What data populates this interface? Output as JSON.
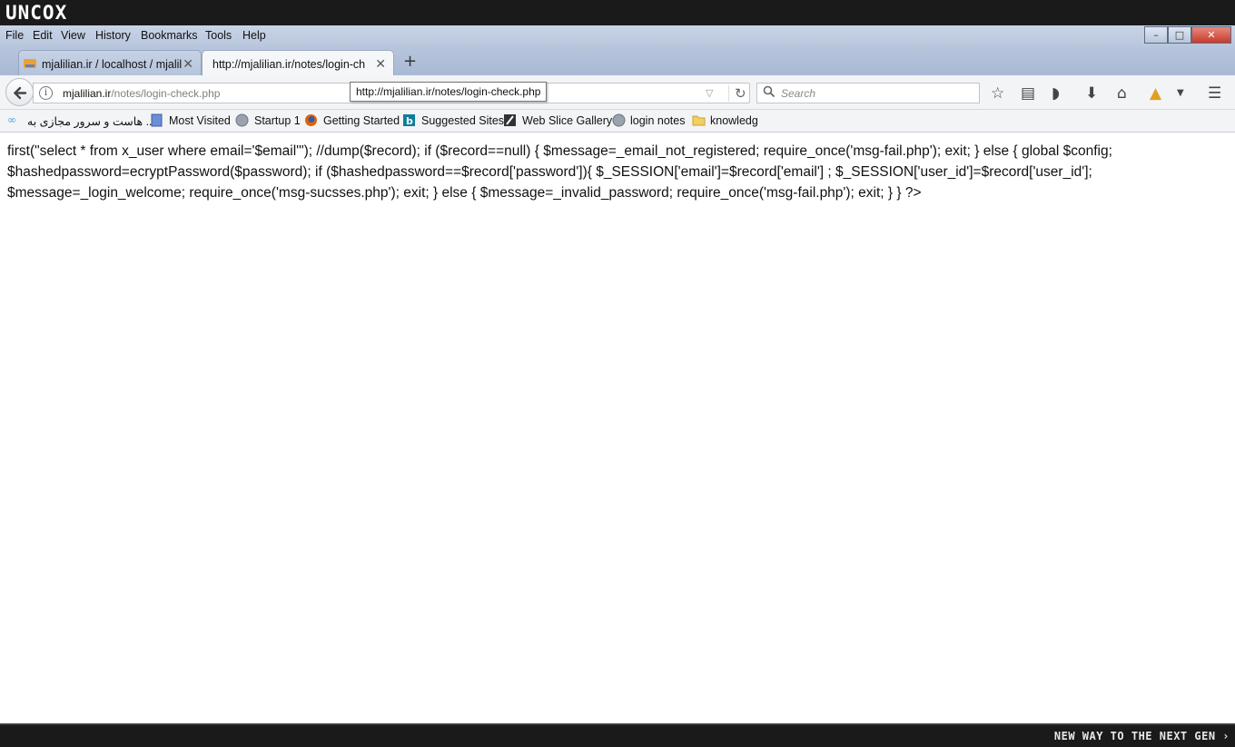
{
  "taskbar": {
    "logo": "UNCOX",
    "slogan": "NEW WAY TO THE NEXT GEN ›"
  },
  "window_controls": {
    "minimize": "–",
    "restore": "□",
    "close": "✕"
  },
  "menubar": {
    "items": [
      "File",
      "Edit",
      "View",
      "History",
      "Bookmarks",
      "Tools",
      "Help"
    ]
  },
  "tabs": [
    {
      "label": "mjalilian.ir / localhost / mjalil",
      "active": false,
      "favicon": "phpmyadmin-icon"
    },
    {
      "label": "http://mjalilian.ir/notes/login-ch",
      "active": true
    }
  ],
  "newtab_label": "+",
  "navbar": {
    "url_host": "mjalilian.ir",
    "url_path": "/notes/login-check.php",
    "tooltip": "http://mjalilian.ir/notes/login-check.php",
    "search_placeholder": "Search"
  },
  "bookmarks": [
    {
      "label": "هاست و سرور مجازی به ...",
      "icon": "link-icon"
    },
    {
      "label": "Most Visited",
      "icon": "bookmark-page-icon"
    },
    {
      "label": "Startup 1",
      "icon": "globe-icon"
    },
    {
      "label": "Getting Started",
      "icon": "firefox-icon"
    },
    {
      "label": "Suggested Sites",
      "icon": "bing-icon"
    },
    {
      "label": "Web Slice Gallery",
      "icon": "webslice-icon"
    },
    {
      "label": "login notes",
      "icon": "globe-icon"
    },
    {
      "label": "knowledg",
      "icon": "folder-icon"
    }
  ],
  "page": {
    "text": "first(\"select * from x_user where email='$email'\"); //dump($record); if ($record==null) { $message=_email_not_registered; require_once('msg-fail.php'); exit; } else { global $config; $hashedpassword=ecryptPassword($password); if ($hashedpassword==$record['password']){ $_SESSION['email']=$record['email'] ; $_SESSION['user_id']=$record['user_id']; $message=_login_welcome; require_once('msg-sucsses.php'); exit; } else { $message=_invalid_password; require_once('msg-fail.php'); exit; } } ?>"
  }
}
